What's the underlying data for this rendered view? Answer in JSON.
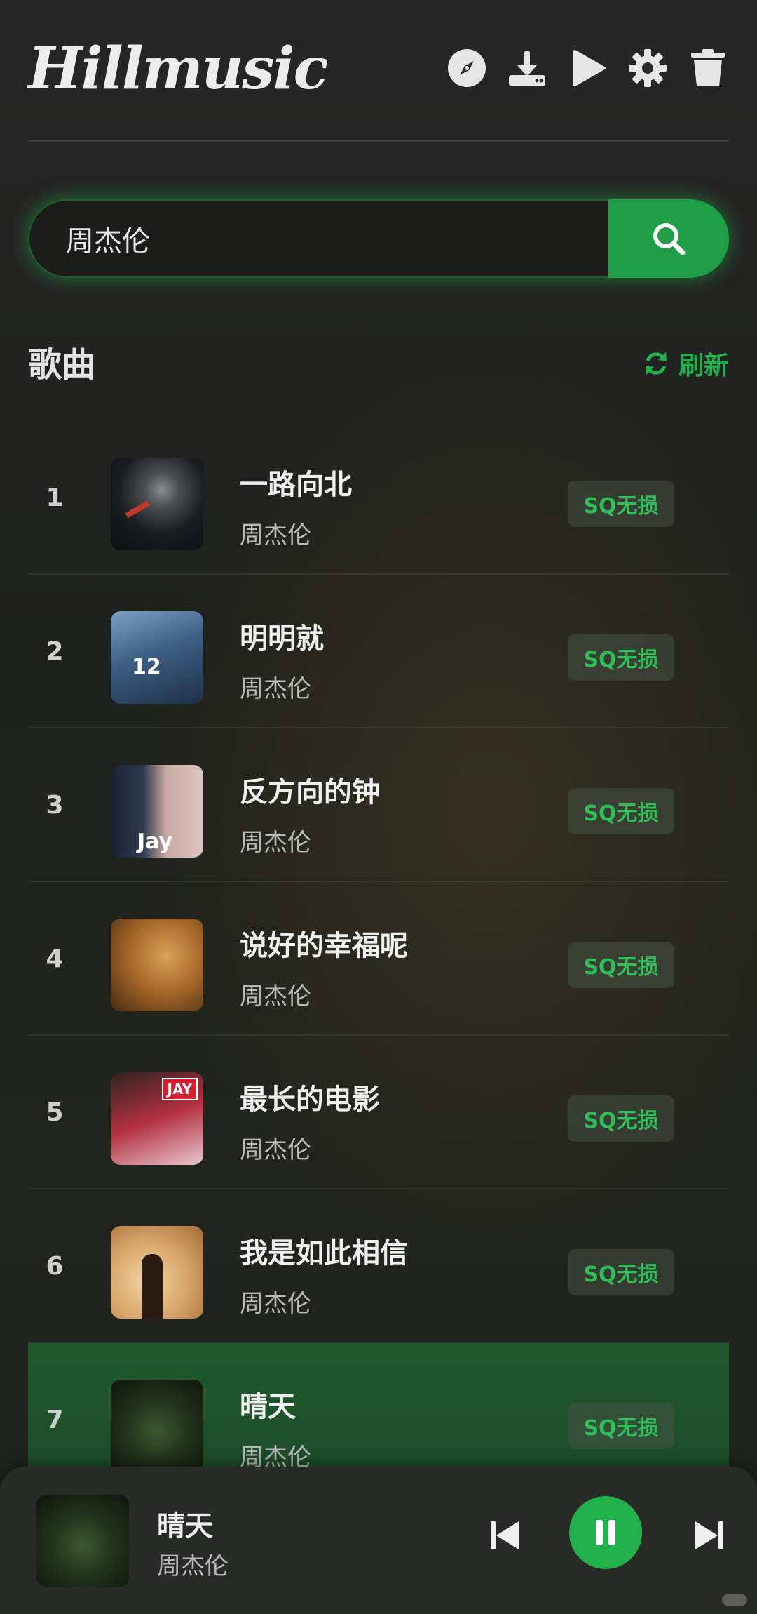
{
  "app": {
    "logo": "Hillmusic"
  },
  "header": {
    "icons": [
      "compass-icon",
      "download-icon",
      "play-icon",
      "gear-icon",
      "trash-icon"
    ]
  },
  "search": {
    "value": "周杰伦"
  },
  "section": {
    "title": "歌曲",
    "refresh_label": "刷新"
  },
  "songs": [
    {
      "num": "1",
      "title": "一路向北",
      "artist": "周杰伦",
      "badge": "SQ无损"
    },
    {
      "num": "2",
      "title": "明明就",
      "artist": "周杰伦",
      "badge": "SQ无损",
      "cover_text": "12"
    },
    {
      "num": "3",
      "title": "反方向的钟",
      "artist": "周杰伦",
      "badge": "SQ无损",
      "cover_text": "Jay"
    },
    {
      "num": "4",
      "title": "说好的幸福呢",
      "artist": "周杰伦",
      "badge": "SQ无损"
    },
    {
      "num": "5",
      "title": "最长的电影",
      "artist": "周杰伦",
      "badge": "SQ无损",
      "cover_text": "JAY"
    },
    {
      "num": "6",
      "title": "我是如此相信",
      "artist": "周杰伦",
      "badge": "SQ无损"
    },
    {
      "num": "7",
      "title": "晴天",
      "artist": "周杰伦",
      "badge": "SQ无损"
    }
  ],
  "player": {
    "title": "晴天",
    "artist": "周杰伦",
    "state": "playing"
  },
  "colors": {
    "accent": "#22b04d",
    "active_row": "#1f5a2d",
    "badge_text": "#2fbf58"
  }
}
